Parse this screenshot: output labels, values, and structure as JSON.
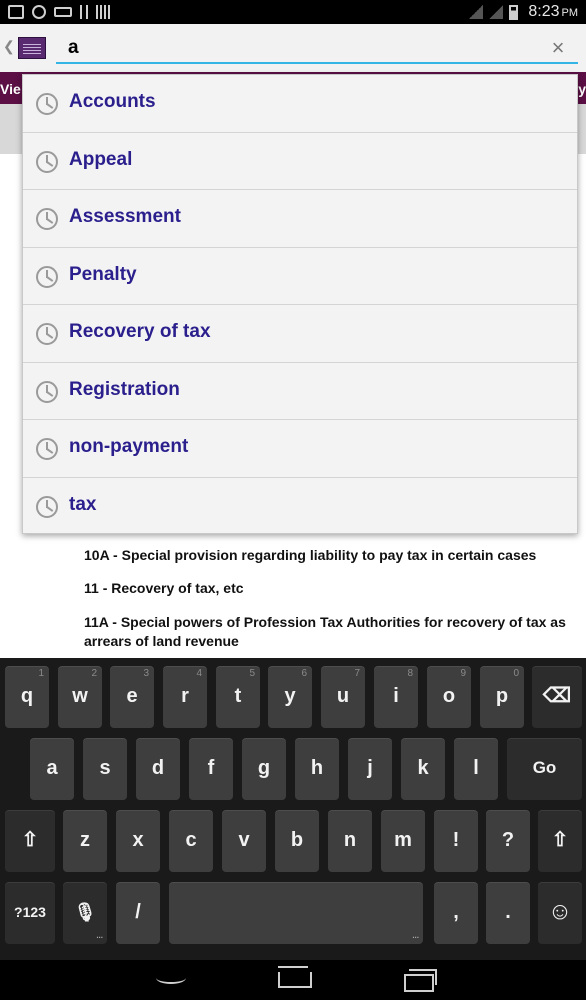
{
  "status_bar": {
    "time": "8:23",
    "time_suffix": "PM"
  },
  "search": {
    "query": "a",
    "clear_icon": "close-icon",
    "clear_glyph": "×"
  },
  "underlying_page": {
    "left_text": "Vie",
    "right_text": "y",
    "sections": [
      "10A - Special provision regarding liability to pay tax in certain cases",
      "11 - Recovery of tax, etc",
      "11A - Special powers of Profession Tax Authorities for recovery of tax as arrears of land revenue"
    ]
  },
  "suggestions": [
    "Accounts",
    "Appeal",
    "Assessment",
    "Penalty",
    "Recovery of tax",
    "Registration",
    "non-payment",
    "tax"
  ],
  "keyboard": {
    "row1": [
      {
        "k": "q",
        "h": "1"
      },
      {
        "k": "w",
        "h": "2"
      },
      {
        "k": "e",
        "h": "3"
      },
      {
        "k": "r",
        "h": "4"
      },
      {
        "k": "t",
        "h": "5"
      },
      {
        "k": "y",
        "h": "6"
      },
      {
        "k": "u",
        "h": "7"
      },
      {
        "k": "i",
        "h": "8"
      },
      {
        "k": "o",
        "h": "9"
      },
      {
        "k": "p",
        "h": "0"
      }
    ],
    "row2": [
      "a",
      "s",
      "d",
      "f",
      "g",
      "h",
      "j",
      "k",
      "l"
    ],
    "go_label": "Go",
    "row3": [
      "z",
      "x",
      "c",
      "v",
      "b",
      "n",
      "m",
      "!",
      "?"
    ],
    "symbols_label": "?123",
    "slash_label": "/",
    "comma_label": ",",
    "period_label": ".",
    "backspace_glyph": "⌫",
    "shift_glyph": "⇧",
    "emoji_glyph": "☺",
    "mic_glyph": "🎙"
  },
  "colors": {
    "suggestion_text": "#2a1f8c",
    "accent": "#33b5e5",
    "header_band": "#5b0f45"
  }
}
